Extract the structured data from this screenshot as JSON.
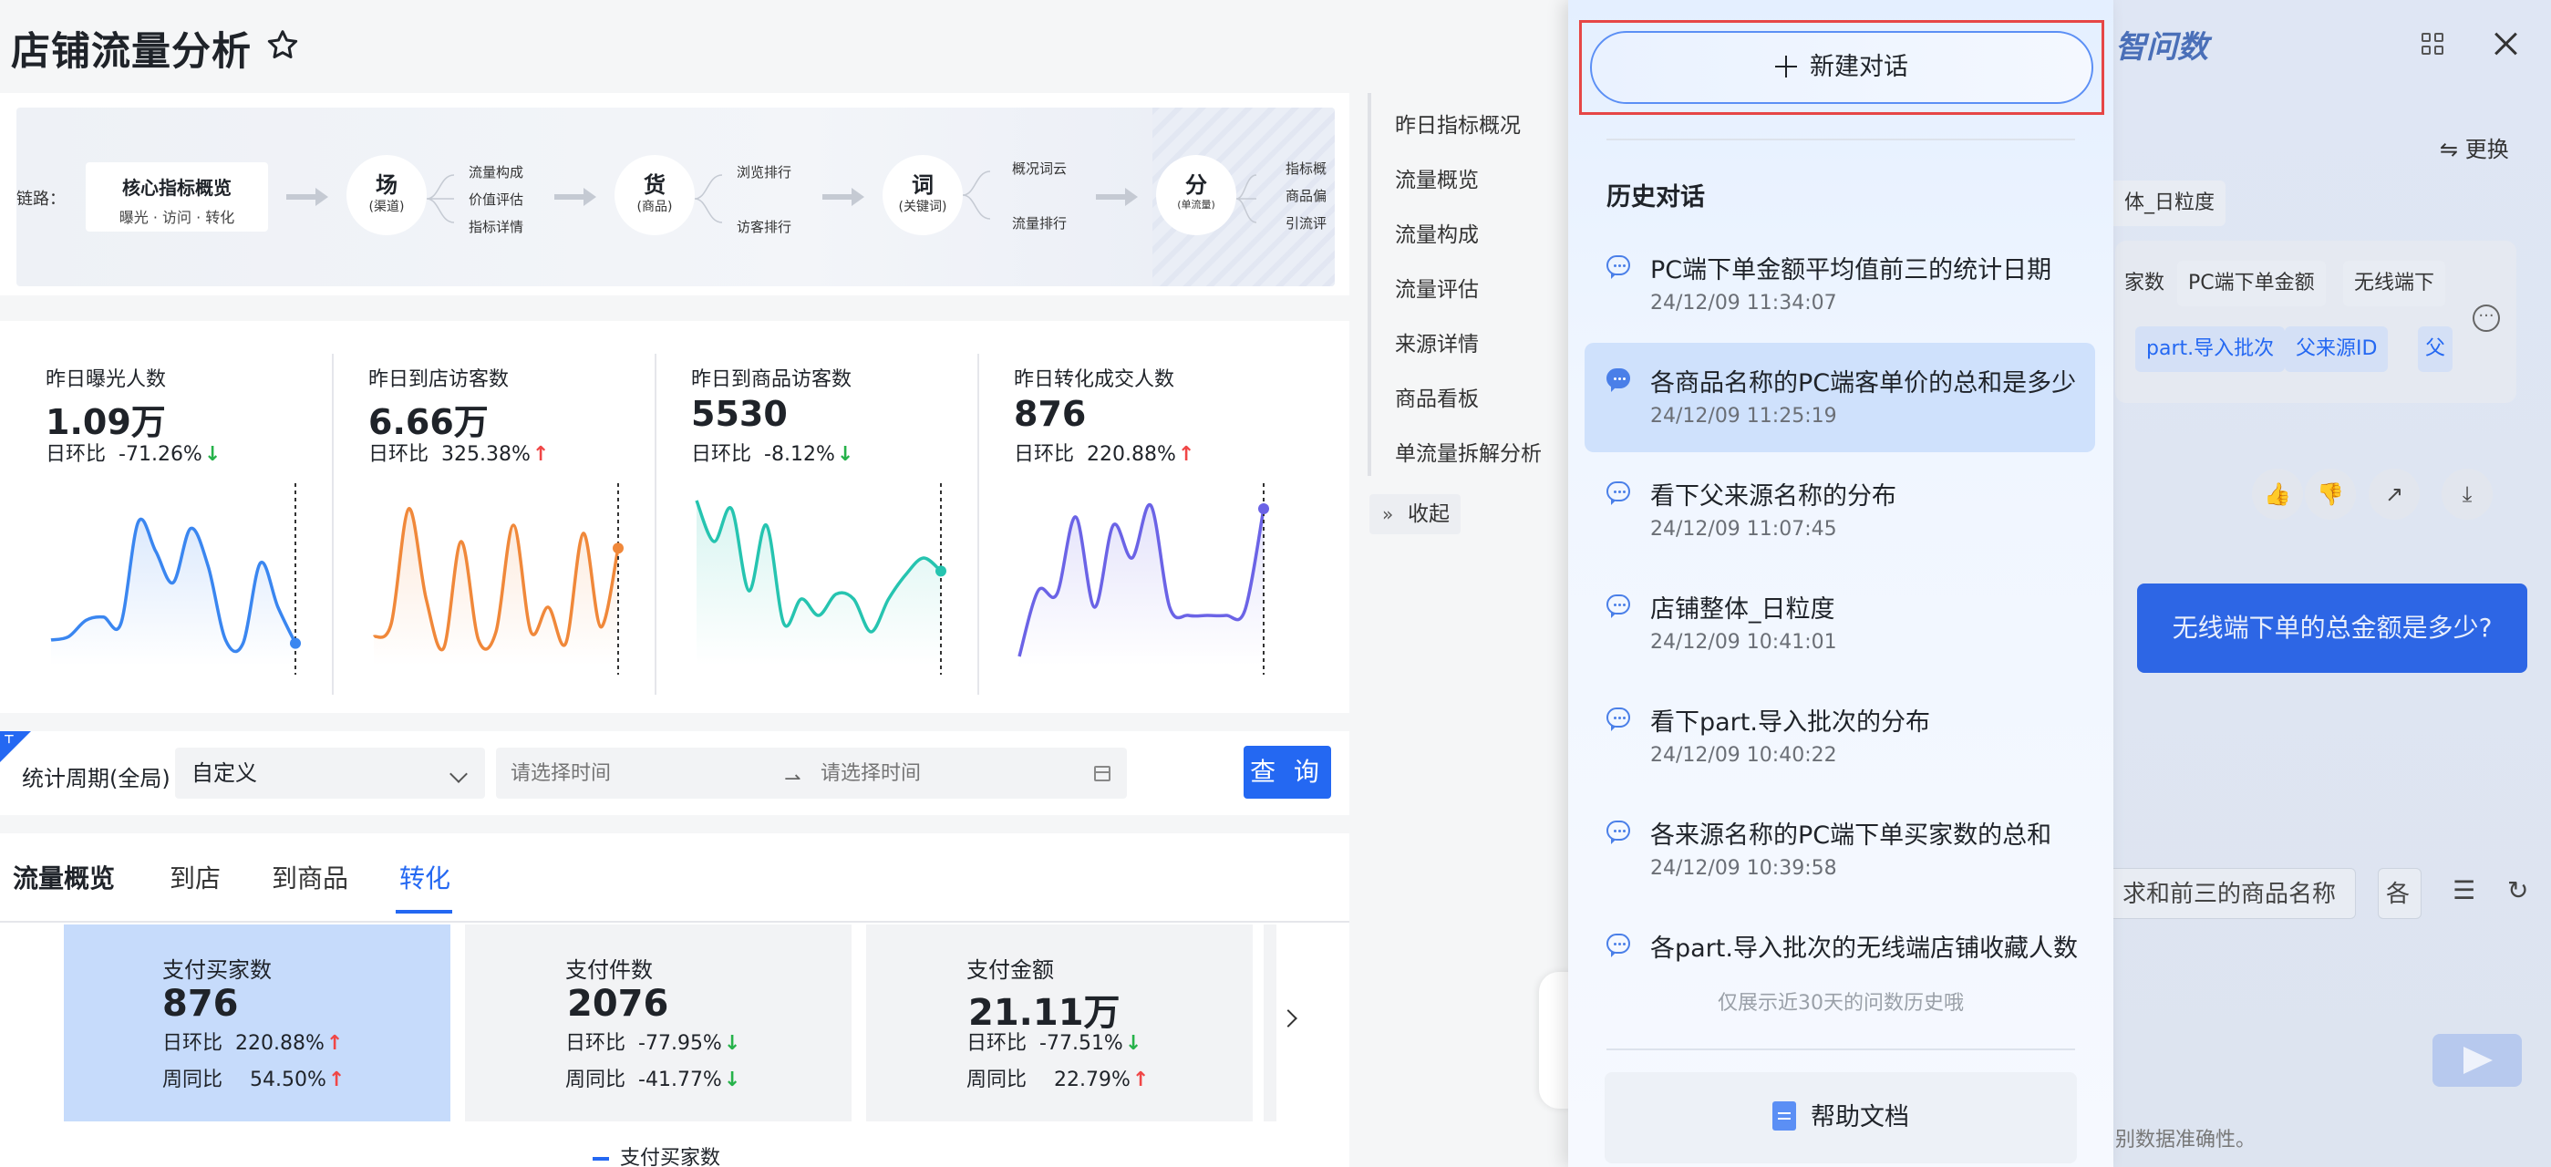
{
  "page": {
    "title": "店铺流量分析"
  },
  "flow": {
    "label": "链路：",
    "core": {
      "title": "核心指标概览",
      "subtitle": "曝光 · 访问 · 转化"
    },
    "nodes": [
      {
        "main": "场",
        "sub": "(渠道)",
        "branches": [
          "流量构成",
          "价值评估",
          "指标详情"
        ]
      },
      {
        "main": "货",
        "sub": "(商品)",
        "branches": [
          "浏览排行",
          "访客排行"
        ]
      },
      {
        "main": "词",
        "sub": "(关键词)",
        "branches": [
          "概况词云",
          "流量排行"
        ]
      },
      {
        "main": "分",
        "sub": "(单流量)",
        "branches": [
          "指标概",
          "商品偏",
          "引流评"
        ]
      }
    ]
  },
  "metrics": [
    {
      "label": "昨日曝光人数",
      "value": "1.09万",
      "cmp_label": "日环比",
      "cmp": "-71.26%",
      "dir": "down",
      "color": "#3a86f0",
      "spark": [
        0.1,
        0.12,
        0.22,
        0.24,
        0.2,
        0.82,
        0.64,
        0.45,
        0.78,
        0.55,
        0.1,
        0.08,
        0.57,
        0.3,
        0.08
      ]
    },
    {
      "label": "昨日到店访客数",
      "value": "6.66万",
      "cmp_label": "日环比",
      "cmp": "325.38%",
      "dir": "up",
      "color": "#f0883a",
      "spark": [
        0.12,
        0.2,
        0.9,
        0.35,
        0.05,
        0.7,
        0.1,
        0.15,
        0.8,
        0.15,
        0.3,
        0.08,
        0.75,
        0.18,
        0.66
      ]
    },
    {
      "label": "昨日到商品访客数",
      "value": "5530",
      "cmp_label": "日环比",
      "cmp": "-8.12%",
      "dir": "down",
      "color": "#26c4b0",
      "spark": [
        0.95,
        0.7,
        0.9,
        0.4,
        0.8,
        0.2,
        0.35,
        0.25,
        0.38,
        0.35,
        0.15,
        0.35,
        0.5,
        0.6,
        0.52
      ]
    },
    {
      "label": "昨日转化成交人数",
      "value": "876",
      "cmp_label": "日环比",
      "cmp": "220.88%",
      "dir": "up",
      "color": "#6b63e6",
      "spark": [
        0.0,
        0.4,
        0.38,
        0.85,
        0.3,
        0.8,
        0.6,
        0.92,
        0.3,
        0.25,
        0.25,
        0.25,
        0.28,
        0.9
      ]
    }
  ],
  "filter": {
    "label": "统计周期(全局)",
    "period": "自定义",
    "start_placeholder": "请选择时间",
    "end_placeholder": "请选择时间",
    "query_label": "查 询"
  },
  "tabs": [
    {
      "label": "流量概览"
    },
    {
      "label": "到店"
    },
    {
      "label": "到商品"
    },
    {
      "label": "转化"
    }
  ],
  "kpis": [
    {
      "label": "支付买家数",
      "value": "876",
      "d_label": "日环比",
      "d": "220.88%",
      "d_dir": "up",
      "w_label": "周同比",
      "w": "54.50%",
      "w_dir": "up"
    },
    {
      "label": "支付件数",
      "value": "2076",
      "d_label": "日环比",
      "d": "-77.95%",
      "d_dir": "down",
      "w_label": "周同比",
      "w": "-41.77%",
      "w_dir": "down"
    },
    {
      "label": "支付金额",
      "value": "21.11万",
      "d_label": "日环比",
      "d": "-77.51%",
      "d_dir": "down",
      "w_label": "周同比",
      "w": "22.79%",
      "w_dir": "up"
    }
  ],
  "legend": "支付买家数",
  "anchor_nav": [
    "昨日指标概况",
    "流量概览",
    "流量构成",
    "流量评估",
    "来源详情",
    "商品看板",
    "单流量拆解分析"
  ],
  "collapse_label": "收起",
  "chat_bg": {
    "title": "智问数",
    "change_label": "更换",
    "chips": [
      "体_日粒度",
      "家数",
      "PC端下单金额",
      "无线端下"
    ],
    "blue_chips": [
      "part.导入批次",
      "父来源ID",
      "父"
    ],
    "question": "无线端下单的总金额是多少?",
    "input_chips": [
      "求和前三的商品名称",
      "各"
    ],
    "disclaimer": "别数据准确性。"
  },
  "history": {
    "new_chat_label": "新建对话",
    "title": "历史对话",
    "items": [
      {
        "q": "PC端下单金额平均值前三的统计日期",
        "t": "24/12/09 11:34:07"
      },
      {
        "q": "各商品名称的PC端客单价的总和是多少",
        "t": "24/12/09 11:25:19"
      },
      {
        "q": "看下父来源名称的分布",
        "t": "24/12/09 11:07:45"
      },
      {
        "q": "店铺整体_日粒度",
        "t": "24/12/09 10:41:01"
      },
      {
        "q": "看下part.导入批次的分布",
        "t": "24/12/09 10:40:22"
      },
      {
        "q": "各来源名称的PC端下单买家数的总和",
        "t": "24/12/09 10:39:58"
      },
      {
        "q": "各part.导入批次的无线端店铺收藏人数",
        "t": ""
      }
    ],
    "note": "仅展示近30天的问数历史哦",
    "help_label": "帮助文档"
  }
}
